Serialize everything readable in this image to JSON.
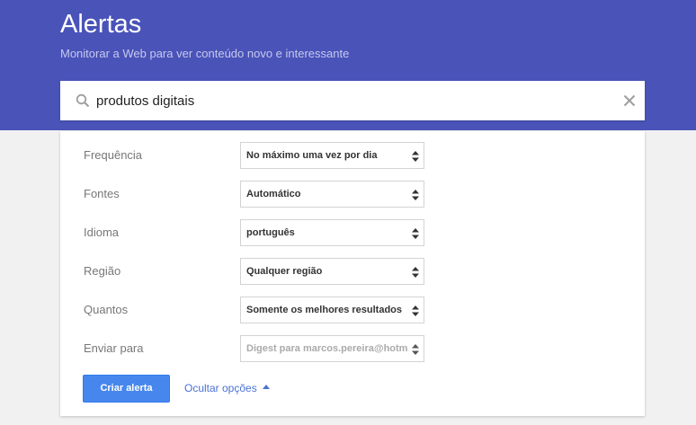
{
  "header": {
    "title": "Alertas",
    "subtitle": "Monitorar a Web para ver conteúdo novo e interessante"
  },
  "search": {
    "value": "produtos digitais"
  },
  "options": [
    {
      "label": "Frequência",
      "value": "No máximo uma vez por dia"
    },
    {
      "label": "Fontes",
      "value": "Automático"
    },
    {
      "label": "Idioma",
      "value": "português"
    },
    {
      "label": "Região",
      "value": "Qualquer região"
    },
    {
      "label": "Quantos",
      "value": "Somente os melhores resultados"
    },
    {
      "label": "Enviar para",
      "value": "Digest para marcos.pereira@hotmar",
      "disabled": true
    }
  ],
  "actions": {
    "create_label": "Criar alerta",
    "hide_options_label": "Ocultar opções"
  },
  "colors": {
    "header_bg": "#4a53b8",
    "primary_button": "#4787ed",
    "link": "#4a72d4"
  },
  "icons": {
    "search": "search-icon",
    "clear": "close-icon",
    "select_arrows": "up-down-arrows-icon",
    "hide_caret": "caret-up-icon"
  }
}
